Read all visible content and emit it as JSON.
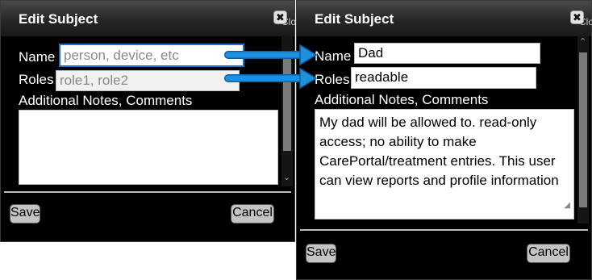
{
  "left_dialog": {
    "title": "Edit Subject",
    "close_clip": "Clo",
    "name_label": "Name",
    "name_placeholder": "person, device, etc",
    "roles_label": "Roles",
    "roles_placeholder": "role1, role2",
    "notes_label": "Additional Notes, Comments",
    "notes_value": "",
    "save_label": "Save",
    "cancel_label": "Cancel"
  },
  "right_dialog": {
    "title": "Edit Subject",
    "close_clip": "Clo",
    "name_label": "Name",
    "name_value": "Dad",
    "roles_label": "Roles",
    "roles_value": "readable",
    "notes_label": "Additional Notes, Comments",
    "notes_value": "My dad will be allowed to. read-only access; no ability to make CarePortal/treatment entries. This user can view reports and profile information",
    "save_label": "Save",
    "cancel_label": "Cancel"
  },
  "callout_arrows": {
    "color": "#1e90e0",
    "icon": "arrow-right-icon"
  }
}
